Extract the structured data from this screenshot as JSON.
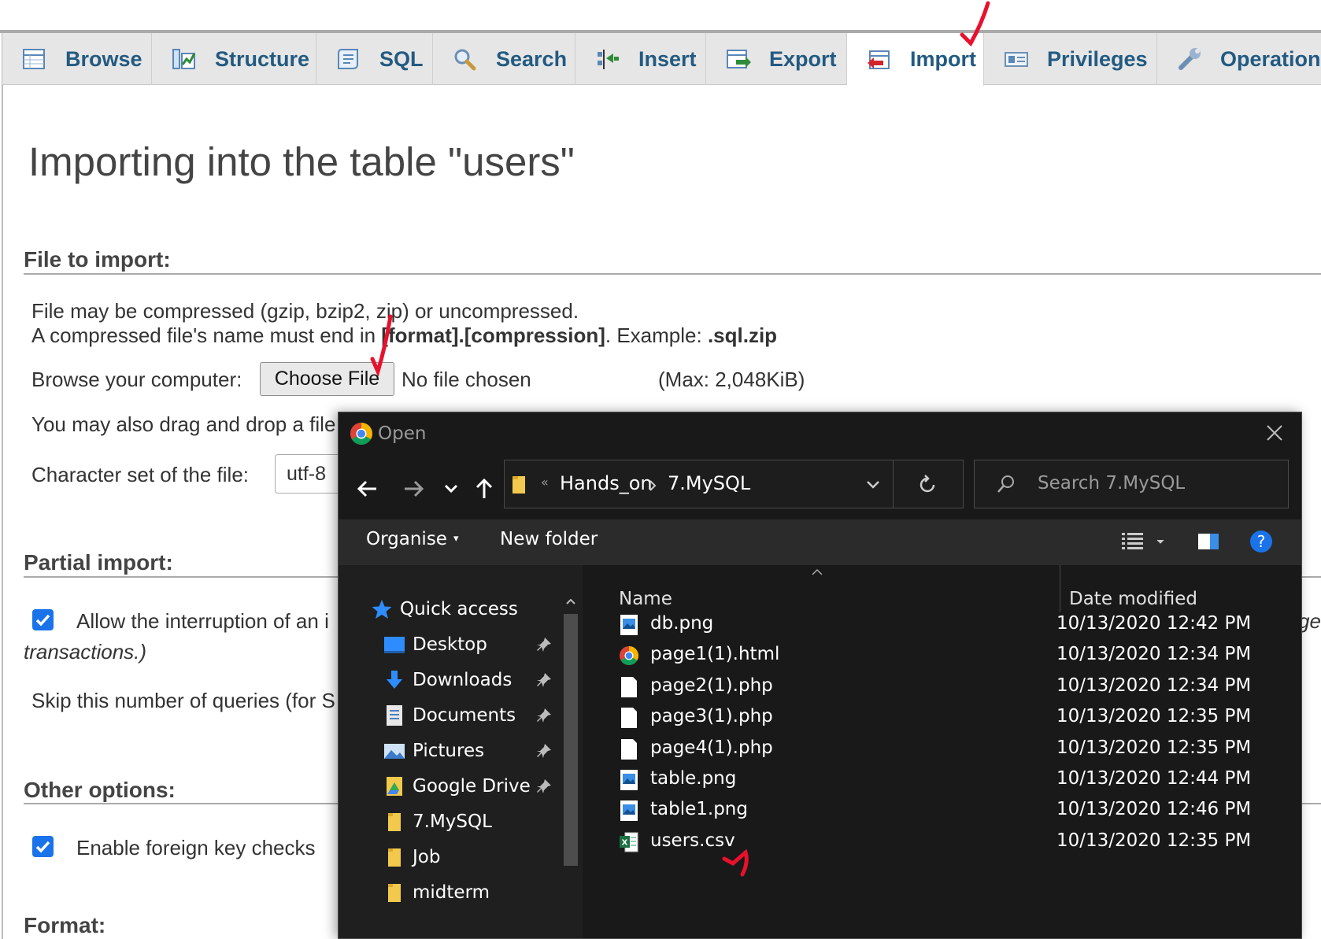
{
  "tabs": [
    {
      "label": "Browse",
      "icon": "browse-icon"
    },
    {
      "label": "Structure",
      "icon": "structure-icon"
    },
    {
      "label": "SQL",
      "icon": "sql-icon"
    },
    {
      "label": "Search",
      "icon": "search-icon"
    },
    {
      "label": "Insert",
      "icon": "insert-icon"
    },
    {
      "label": "Export",
      "icon": "export-icon"
    },
    {
      "label": "Import",
      "icon": "import-icon",
      "active": true
    },
    {
      "label": "Privileges",
      "icon": "privileges-icon"
    },
    {
      "label": "Operation",
      "icon": "wrench-icon"
    }
  ],
  "page": {
    "title": "Importing into the table \"users\""
  },
  "file_import": {
    "heading": "File to import:",
    "line1": "File may be compressed (gzip, bzip2, zip) or uncompressed.",
    "line2_prefix": "A compressed file's name must end in ",
    "line2_format": "[format].[compression]",
    "line2_mid": ". Example: ",
    "line2_example": ".sql.zip",
    "browse_label": "Browse your computer:",
    "choose_button": "Choose File",
    "no_file": "No file chosen",
    "max_size": "(Max: 2,048KiB)",
    "drag_text": "You may also drag and drop a file",
    "charset_label": "Character set of the file:",
    "charset_value": "utf-8"
  },
  "partial_import": {
    "heading": "Partial import:",
    "interrupt_text": "Allow the interruption of an i",
    "interrupt_checked": true,
    "interrupt_suffix": "ge",
    "transactions_text": "transactions.)",
    "skip_text": "Skip this number of queries (for S"
  },
  "other_options": {
    "heading": "Other options:",
    "fk_text": "Enable foreign key checks",
    "fk_checked": true
  },
  "format": {
    "heading": "Format:"
  },
  "dialog": {
    "title": "Open",
    "path": [
      "Hands_on",
      "7.MySQL"
    ],
    "search_placeholder": "Search 7.MySQL",
    "toolbar": {
      "organise": "Organise",
      "new_folder": "New folder"
    },
    "nav": [
      {
        "label": "Quick access",
        "icon": "star-icon",
        "pinned": false
      },
      {
        "label": "Desktop",
        "icon": "desktop-icon",
        "pinned": true
      },
      {
        "label": "Downloads",
        "icon": "download-icon",
        "pinned": true
      },
      {
        "label": "Documents",
        "icon": "documents-icon",
        "pinned": true
      },
      {
        "label": "Pictures",
        "icon": "pictures-icon",
        "pinned": true
      },
      {
        "label": "Google Drive",
        "icon": "google-drive-icon",
        "pinned": true
      },
      {
        "label": "7.MySQL",
        "icon": "folder-icon",
        "pinned": false
      },
      {
        "label": "Job",
        "icon": "folder-icon",
        "pinned": false
      },
      {
        "label": "midterm",
        "icon": "folder-icon",
        "pinned": false
      }
    ],
    "columns": {
      "name": "Name",
      "date": "Date modified"
    },
    "files": [
      {
        "name": "db.png",
        "date": "10/13/2020 12:42 PM",
        "type": "image"
      },
      {
        "name": "page1(1).html",
        "date": "10/13/2020 12:34 PM",
        "type": "chrome"
      },
      {
        "name": "page2(1).php",
        "date": "10/13/2020 12:34 PM",
        "type": "blank"
      },
      {
        "name": "page3(1).php",
        "date": "10/13/2020 12:35 PM",
        "type": "blank"
      },
      {
        "name": "page4(1).php",
        "date": "10/13/2020 12:35 PM",
        "type": "blank"
      },
      {
        "name": "table.png",
        "date": "10/13/2020 12:44 PM",
        "type": "image"
      },
      {
        "name": "table1.png",
        "date": "10/13/2020 12:46 PM",
        "type": "image"
      },
      {
        "name": "users.csv",
        "date": "10/13/2020 12:35 PM",
        "type": "excel"
      }
    ]
  },
  "colors": {
    "tab_text": "#235a81",
    "checkbox": "#1a73e8",
    "annotation": "#e8112d",
    "dialog_bg": "#191919"
  }
}
